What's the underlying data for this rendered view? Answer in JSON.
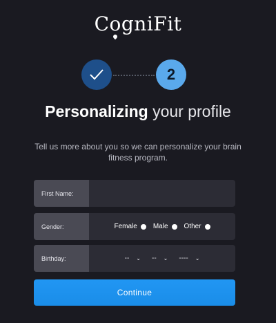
{
  "logo": {
    "pre": "C",
    "o": "o",
    "post": "gniFit"
  },
  "steps": {
    "step1_icon": "checkmark-icon",
    "step2_number": "2"
  },
  "headline": {
    "bold": "Personalizing",
    "rest": " your profile"
  },
  "description": "Tell us more about you so we can personalize your brain fitness program.",
  "form": {
    "first_name": {
      "label": "First Name:",
      "value": ""
    },
    "gender": {
      "label": "Gender:",
      "options": [
        "Female",
        "Male",
        "Other"
      ]
    },
    "birthday": {
      "label": "Birthday:",
      "month": "--",
      "day": "--",
      "year": "----"
    }
  },
  "continue_label": "Continue",
  "colors": {
    "background": "#1a1a21",
    "step_done": "#1e4f8a",
    "step_active": "#5aa9ec",
    "button": "#2196f3"
  }
}
